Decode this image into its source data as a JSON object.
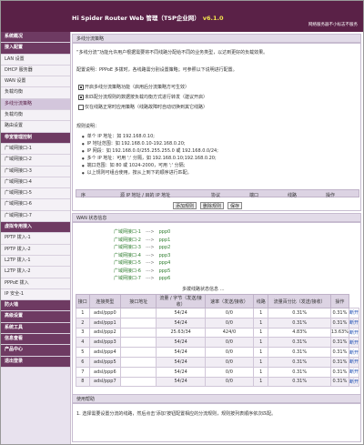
{
  "header": {
    "title": "Hi Spider Router Web 管理（TSP企业网）",
    "version": "v6.1.0",
    "right_text": "网络服务器不小标志不服务"
  },
  "sidebar": {
    "items": [
      {
        "label": "系统概况",
        "section": true
      },
      {
        "label": "接入配置",
        "section": true
      },
      {
        "label": "LAN 设置"
      },
      {
        "label": "DHCP 服务器"
      },
      {
        "label": "WAN 设置"
      },
      {
        "label": "负载均衡"
      },
      {
        "label": "多线分流策略",
        "active": true
      },
      {
        "label": "负载均衡"
      },
      {
        "label": "路由设置"
      },
      {
        "label": "带宽管理控制",
        "section": true
      },
      {
        "label": "广域网接口-1"
      },
      {
        "label": "广域网接口-2"
      },
      {
        "label": "广域网接口-3"
      },
      {
        "label": "广域网接口-4"
      },
      {
        "label": "广域网接口-5"
      },
      {
        "label": "广域网接口-6"
      },
      {
        "label": "广域网接口-7"
      },
      {
        "label": "虚拟专用接入",
        "section": true
      },
      {
        "label": "PPTP 拨入-1"
      },
      {
        "label": "PPTP 拨入-2"
      },
      {
        "label": "L2TP 拨入-1"
      },
      {
        "label": "L2TP 拨入-2"
      },
      {
        "label": "PPPoE 拨入"
      },
      {
        "label": "IP 安全-1"
      },
      {
        "label": "防火墙",
        "section": true
      },
      {
        "label": "高级设置",
        "section": true
      },
      {
        "label": "系统工具",
        "section": true
      },
      {
        "label": "信息查看",
        "section": true
      },
      {
        "label": "产品中心",
        "section": true
      },
      {
        "label": "退出登录",
        "section": true
      }
    ]
  },
  "config_panel": {
    "title": "多线分流策略",
    "intro": [
      "“多线分流”功能允许用户根据需要将不同线路分配给不同的业务类型，以达到更好的负载效果。",
      "配置说明：PPPoE 多拨时，各线路需分别设置策略；可参照以下说明进行配置。"
    ],
    "checkboxes": [
      {
        "label": "开启多线分流策略功能（启用后分流策略方可生效）",
        "checked": true
      },
      {
        "label": "未匹配分流规则的数据按负载均衡方式进行转发（建议开启）",
        "checked": true
      },
      {
        "label": "仅在线路正常时应用策略（线路故障时自动切换到其它线路）",
        "checked": false
      }
    ],
    "rule_heading": "规则说明：",
    "rules": [
      "单个 IP 地址：如 192.168.0.10;",
      "IP 地址范围：如 192.168.0.10-192.168.0.20;",
      "IP 网段：如 192.168.0.0/255.255.255.0 或 192.168.0.0/24;",
      "多个 IP 地址：可用 ';' 分隔，如 192.168.0.10;192.168.0.20;",
      "端口范围：如 80 或 1024-2000，可用 ';' 分隔;",
      "以上规则可组合使用，按从上到下的顺序进行匹配。"
    ]
  },
  "rule_table": {
    "headers": [
      "序",
      "源 IP 地址 / 目的 IP 地址",
      "协议",
      "端口",
      "线路",
      "操作"
    ],
    "buttons": {
      "add": "添加规则",
      "delete": "删除规则",
      "save": "保存"
    }
  },
  "wan_panel": {
    "title": "WAN 状态信息",
    "mapping": [
      {
        "src": "广域网接口-1",
        "arrow": "--->",
        "dst": "ppp0"
      },
      {
        "src": "广域网接口-2",
        "arrow": "--->",
        "dst": "ppp1"
      },
      {
        "src": "广域网接口-3",
        "arrow": "--->",
        "dst": "ppp2"
      },
      {
        "src": "广域网接口-4",
        "arrow": "--->",
        "dst": "ppp3"
      },
      {
        "src": "广域网接口-5",
        "arrow": "--->",
        "dst": "ppp4"
      },
      {
        "src": "广域网接口-6",
        "arrow": "--->",
        "dst": "ppp5"
      },
      {
        "src": "广域网接口-7",
        "arrow": "--->",
        "dst": "ppp6"
      }
    ],
    "legend": "多拨线路状态信息 …"
  },
  "status_table": {
    "headers": [
      "接口",
      "连接类型",
      "接口地址",
      "流量 / 字节（发送/接收）",
      "速率（发送/接收）",
      "线路",
      "流量百分比（发送/接收）",
      "操作"
    ],
    "rows": [
      {
        "idx": "1",
        "type": "adsl/ppp0",
        "addr": "",
        "traffic": "54/24",
        "rate": "0/0",
        "line": "1",
        "pct1": "0.31%",
        "pct2": "0.31%",
        "act": "断开"
      },
      {
        "idx": "2",
        "type": "adsl/ppp1",
        "addr": "",
        "traffic": "54/24",
        "rate": "0/0",
        "line": "1",
        "pct1": "0.31%",
        "pct2": "0.31%",
        "act": "断开"
      },
      {
        "idx": "3",
        "type": "adsl/ppp2",
        "addr": "",
        "traffic": "25.63/34",
        "rate": "424/0",
        "line": "1",
        "pct1": "4.83%",
        "pct2": "13.63%",
        "act": "断开"
      },
      {
        "idx": "4",
        "type": "adsl/ppp3",
        "addr": "",
        "traffic": "54/24",
        "rate": "0/0",
        "line": "1",
        "pct1": "0.31%",
        "pct2": "0.31%",
        "act": "断开"
      },
      {
        "idx": "5",
        "type": "adsl/ppp4",
        "addr": "",
        "traffic": "54/24",
        "rate": "0/0",
        "line": "1",
        "pct1": "0.31%",
        "pct2": "0.31%",
        "act": "断开"
      },
      {
        "idx": "6",
        "type": "adsl/ppp5",
        "addr": "",
        "traffic": "54/24",
        "rate": "0/0",
        "line": "1",
        "pct1": "0.31%",
        "pct2": "0.31%",
        "act": "断开"
      },
      {
        "idx": "7",
        "type": "adsl/ppp6",
        "addr": "",
        "traffic": "54/24",
        "rate": "0/0",
        "line": "1",
        "pct1": "0.31%",
        "pct2": "0.31%",
        "act": "断开"
      },
      {
        "idx": "8",
        "type": "adsl/ppp7",
        "addr": "",
        "traffic": "54/24",
        "rate": "0/0",
        "line": "1",
        "pct1": "0.31%",
        "pct2": "0.31%",
        "act": "断开"
      }
    ]
  },
  "help_panel": {
    "title": "使用帮助",
    "text": "1. 选择需要设置分流的线路，然后点击'添加'按钮配置相应的分流规则，规则按列表顺序依次匹配。"
  },
  "colors": {
    "brand": "#5a2147",
    "accent_version": "#f2e24d",
    "link": "#1f4fb3",
    "ok": "#2e7d2e"
  }
}
